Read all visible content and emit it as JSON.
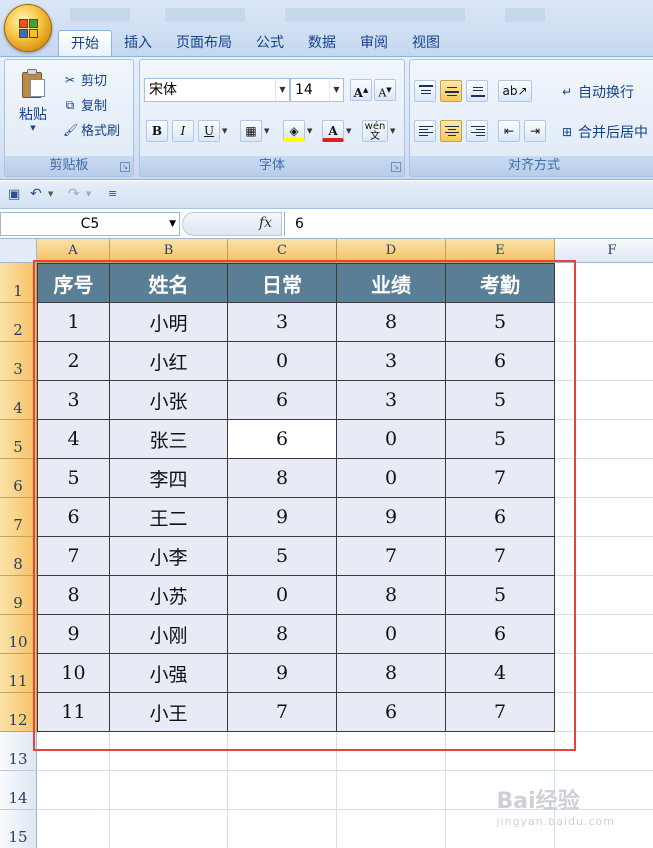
{
  "ribbon_tabs": [
    "开始",
    "插入",
    "页面布局",
    "公式",
    "数据",
    "审阅",
    "视图"
  ],
  "clipboard": {
    "paste": "粘贴",
    "cut": "剪切",
    "copy": "复制",
    "format_painter": "格式刷",
    "label": "剪贴板"
  },
  "font": {
    "name": "宋体",
    "size": "14",
    "label": "字体",
    "grow": "A",
    "shrink": "A",
    "bold": "B",
    "italic": "I",
    "underline": "U",
    "phonetic": "wén"
  },
  "alignment": {
    "wrap_text": "自动换行",
    "merge_center": "合并后居中",
    "label": "对齐方式"
  },
  "formula_bar": {
    "cell_ref": "C5",
    "fx": "fx",
    "value": "6"
  },
  "columns": [
    "A",
    "B",
    "C",
    "D",
    "E",
    "F"
  ],
  "rows": [
    "1",
    "2",
    "3",
    "4",
    "5",
    "6",
    "7",
    "8",
    "9",
    "10",
    "11",
    "12",
    "13",
    "14",
    "15"
  ],
  "table": {
    "headers": [
      "序号",
      "姓名",
      "日常",
      "业绩",
      "考勤"
    ],
    "rows": [
      [
        "1",
        "小明",
        "3",
        "8",
        "5"
      ],
      [
        "2",
        "小红",
        "0",
        "3",
        "6"
      ],
      [
        "3",
        "小张",
        "6",
        "3",
        "5"
      ],
      [
        "4",
        "张三",
        "6",
        "0",
        "5"
      ],
      [
        "5",
        "李四",
        "8",
        "0",
        "7"
      ],
      [
        "6",
        "王二",
        "9",
        "9",
        "6"
      ],
      [
        "7",
        "小李",
        "5",
        "7",
        "7"
      ],
      [
        "8",
        "小苏",
        "0",
        "8",
        "5"
      ],
      [
        "9",
        "小刚",
        "8",
        "0",
        "6"
      ],
      [
        "10",
        "小强",
        "9",
        "8",
        "4"
      ],
      [
        "11",
        "小王",
        "7",
        "6",
        "7"
      ]
    ]
  },
  "watermark": {
    "brand": "Bai经验",
    "url": "jingyan.baidu.com"
  },
  "colors": {
    "header_fill": "#5a7f94",
    "body_fill": "#e8ebf6",
    "highlight_frame": "#e8423d",
    "selection": "#f7c064"
  }
}
